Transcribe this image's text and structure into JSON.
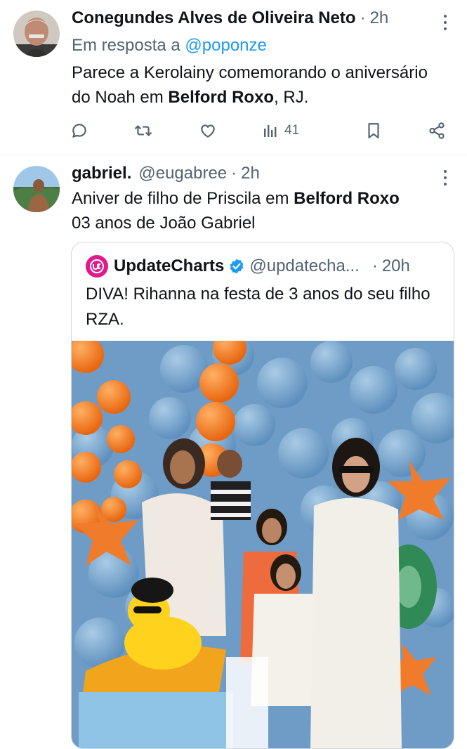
{
  "tweet1": {
    "author_name": "Conegundes Alves de Oliveira Neto",
    "separator": "·",
    "time": "2h",
    "reply_prefix": "Em resposta a",
    "reply_handle": "@poponze",
    "text_before": "Parece a Kerolainy comemorando o aniversário do Noah em ",
    "text_bold": "Belford Roxo",
    "text_after": ", RJ.",
    "actions": {
      "reply_icon": "comment-icon",
      "retweet_icon": "retweet-icon",
      "like_icon": "heart-icon",
      "views_icon": "bar-chart-icon",
      "views_count": "41",
      "bookmark_icon": "bookmark-icon",
      "share_icon": "share-icon"
    }
  },
  "tweet2": {
    "author_name": "gabriel.",
    "handle": "@eugabree",
    "separator": "·",
    "time": "2h",
    "line1_before": "Aniver de filho de Priscila em ",
    "line1_bold": "Belford Roxo",
    "line2": "03 anos de João Gabriel",
    "quote": {
      "author_name": "UpdateCharts",
      "handle": "@updatecha...",
      "separator": "·",
      "time": "20h",
      "text": "DIVA! Rihanna na festa de 3 anos do seu filho RZA.",
      "logo_icon": "updatecharts-logo-icon",
      "verified_icon": "verified-badge-icon"
    }
  },
  "colors": {
    "text": "#0f1419",
    "muted": "#536471",
    "link": "#1d9bf0",
    "verified": "#1d9bf0",
    "divider": "#eff3f4",
    "quote_border": "#cfd9de"
  }
}
